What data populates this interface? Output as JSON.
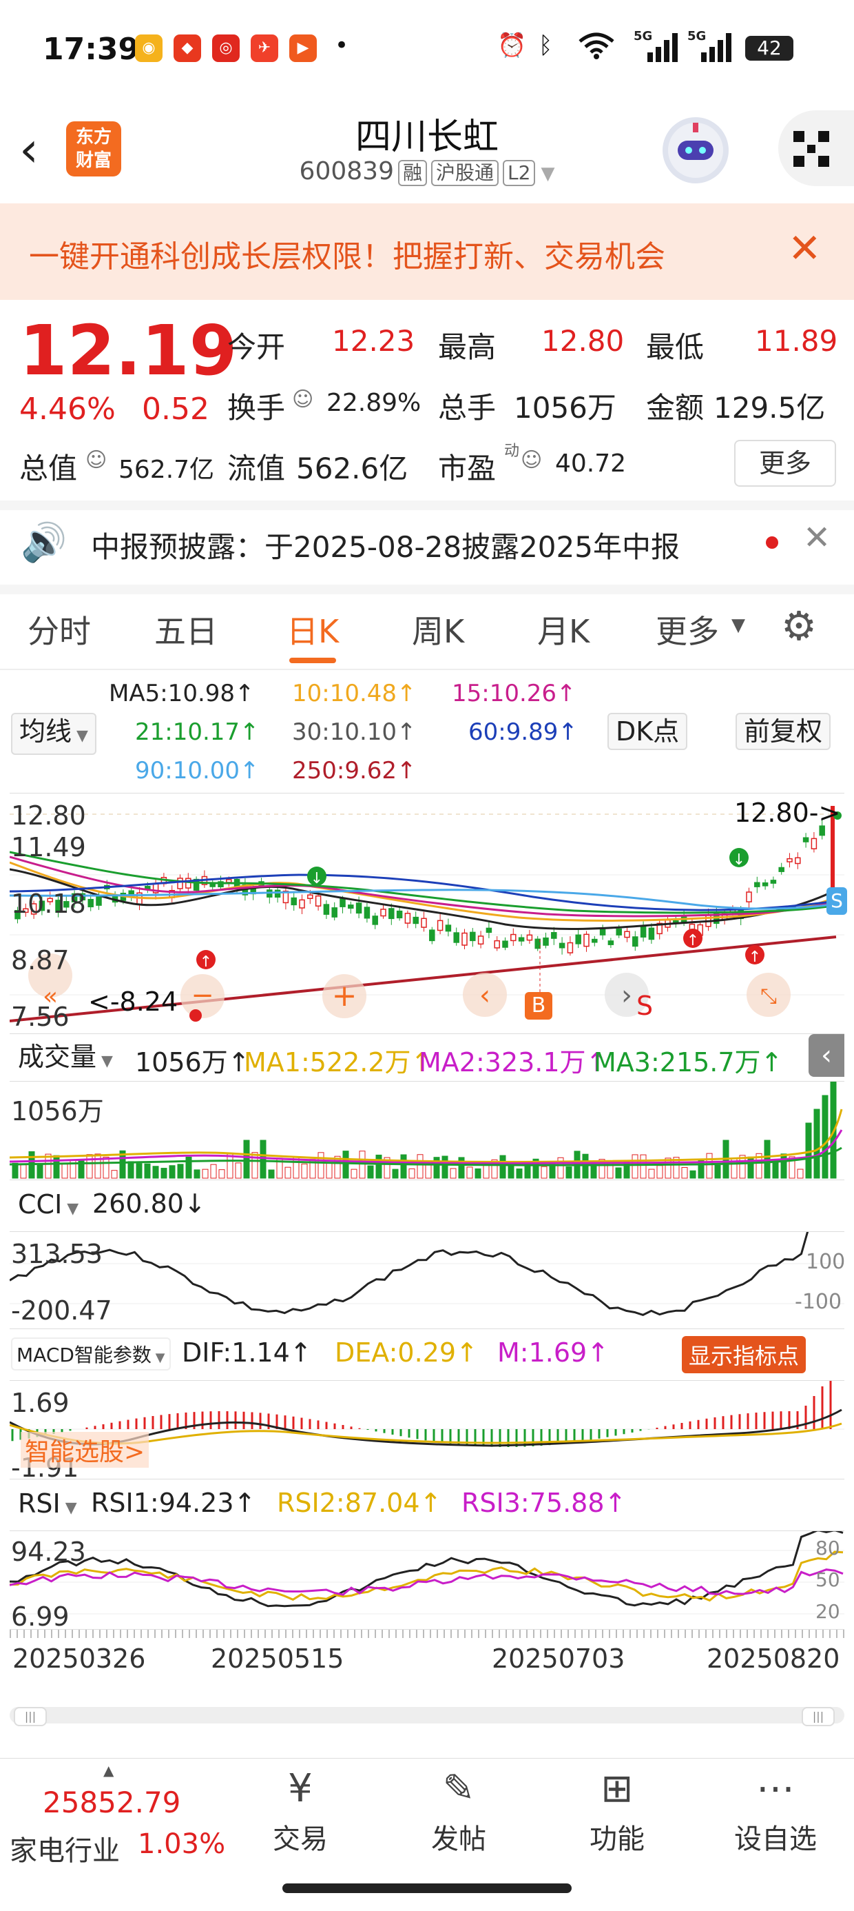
{
  "status_bar": {
    "time": "17:39",
    "app_icons": [
      "weibo-icon",
      "jd-icon",
      "netease-icon",
      "toutiao-icon",
      "video-icon"
    ],
    "dot": "•",
    "signal1": "5G",
    "signal2": "5G",
    "battery": "42"
  },
  "header": {
    "logo_line1": "东方",
    "logo_line2": "财富",
    "title": "四川长虹",
    "code": "600839",
    "tags": [
      "融",
      "沪股通",
      "L2"
    ]
  },
  "banner": {
    "text": "一键开通科创成长层权限！把握打新、交易机会"
  },
  "quote": {
    "price": "12.19",
    "change_pct": "4.46%",
    "change": "0.52",
    "open_label": "今开",
    "open": "12.23",
    "high_label": "最高",
    "high": "12.80",
    "low_label": "最低",
    "low": "11.89",
    "turnover_label": "换手",
    "turnover": "22.89%",
    "volume_label": "总手",
    "volume": "1056万",
    "amount_label": "金额",
    "amount": "129.5亿",
    "mktcap_label": "总值",
    "mktcap": "562.7亿",
    "float_label": "流值",
    "float": "562.6亿",
    "pe_label": "市盈",
    "pe_sup": "动",
    "pe": "40.72",
    "more": "更多"
  },
  "notice": {
    "text": "中报预披露：于2025-08-28披露2025年中报"
  },
  "tabs": [
    {
      "label": "分时",
      "active": false
    },
    {
      "label": "五日",
      "active": false
    },
    {
      "label": "日K",
      "active": true
    },
    {
      "label": "周K",
      "active": false
    },
    {
      "label": "月K",
      "active": false
    },
    {
      "label": "更多",
      "active": false
    }
  ],
  "ma_legend": {
    "selector": "均线",
    "ma5": "MA5:10.98↑",
    "ma10": "10:10.48↑",
    "ma15": "15:10.26↑",
    "ma21": "21:10.17↑",
    "ma30": "30:10.10↑",
    "ma60": "60:9.89↑",
    "ma90": "90:10.00↑",
    "ma250": "250:9.62↑",
    "dk_button": "DK点",
    "adjust_button": "前复权",
    "colors": {
      "ma5": "#222222",
      "ma10": "#f0a81e",
      "ma15": "#c81e8c",
      "ma21": "#1a9e2e",
      "ma30": "#555555",
      "ma60": "#1c3fb8",
      "ma90": "#4aa8e8",
      "ma250": "#b01e2a"
    }
  },
  "kline": {
    "y_labels": [
      "12.80",
      "11.49",
      "10.18",
      "8.87",
      "7.56"
    ],
    "high_marker": "12.80->",
    "low_marker": "<-8.24",
    "b_marker": "B",
    "s_marker": "S"
  },
  "volume": {
    "selector": "成交量",
    "value": "1056万↑",
    "ma1": "MA1:522.2万↑",
    "ma2": "MA2:323.1万↑",
    "ma3": "MA3:215.7万↑",
    "y_label": "1056万"
  },
  "cci": {
    "selector": "CCI",
    "value": "260.80↓",
    "y_top": "313.53",
    "y_bottom": "-200.47",
    "right_mid": "100",
    "right_low": "-100"
  },
  "macd": {
    "selector": "MACD智能参数",
    "dif": "DIF:1.14↑",
    "dea": "DEA:0.29↑",
    "m": "M:1.69↑",
    "show_button": "显示指标点",
    "y_top": "1.69",
    "y_bottom": "-1.91",
    "smart_pick": "智能选股>"
  },
  "rsi": {
    "selector": "RSI",
    "rsi1": "RSI1:94.23↑",
    "rsi2": "RSI2:87.04↑",
    "rsi3": "RSI3:75.88↑",
    "y_top": "94.23",
    "y_bottom": "6.99",
    "right_80": "80",
    "right_50": "50",
    "right_20": "20"
  },
  "x_dates": [
    "20250326",
    "20250515",
    "20250703",
    "20250820"
  ],
  "bottom": {
    "index_value": "25852.79",
    "industry": "家电行业",
    "industry_chg": "1.03%",
    "nav": [
      {
        "label": "交易",
        "icon": "yen-icon"
      },
      {
        "label": "发帖",
        "icon": "edit-icon"
      },
      {
        "label": "功能",
        "icon": "grid-icon"
      },
      {
        "label": "设自选",
        "icon": "more-icon"
      }
    ]
  }
}
